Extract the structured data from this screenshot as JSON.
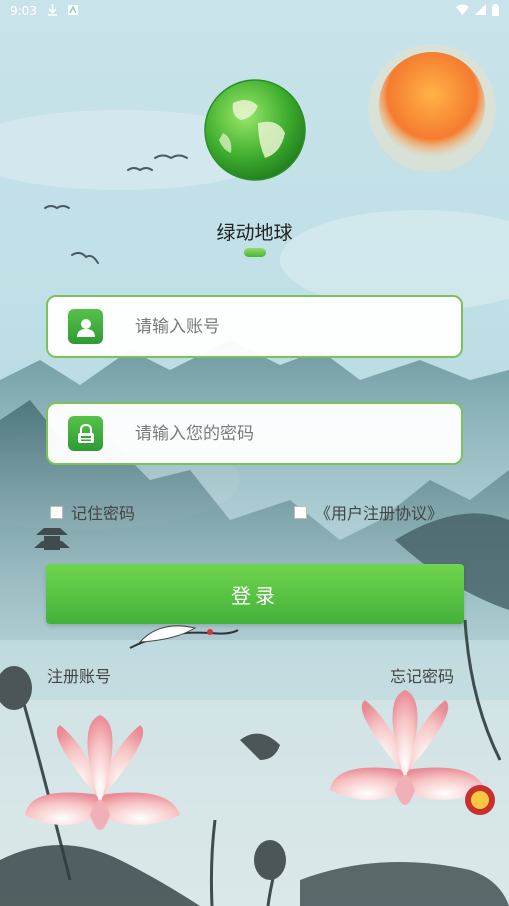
{
  "status_bar": {
    "time": "9:03"
  },
  "app": {
    "title": "绿动地球"
  },
  "form": {
    "account_placeholder": "请输入账号",
    "password_placeholder": "请输入您的密码",
    "remember_label": "记住密码",
    "agreement_label": "《用户注册协议》",
    "login_label": "登录",
    "register_label": "注册账号",
    "forgot_label": "忘记密码"
  },
  "icons": {
    "account": "user-icon",
    "password": "lock-icon",
    "globe": "globe-icon",
    "sun": "sun-icon"
  },
  "colors": {
    "accent": "#4fb23a",
    "field_border": "#7cc25c"
  }
}
